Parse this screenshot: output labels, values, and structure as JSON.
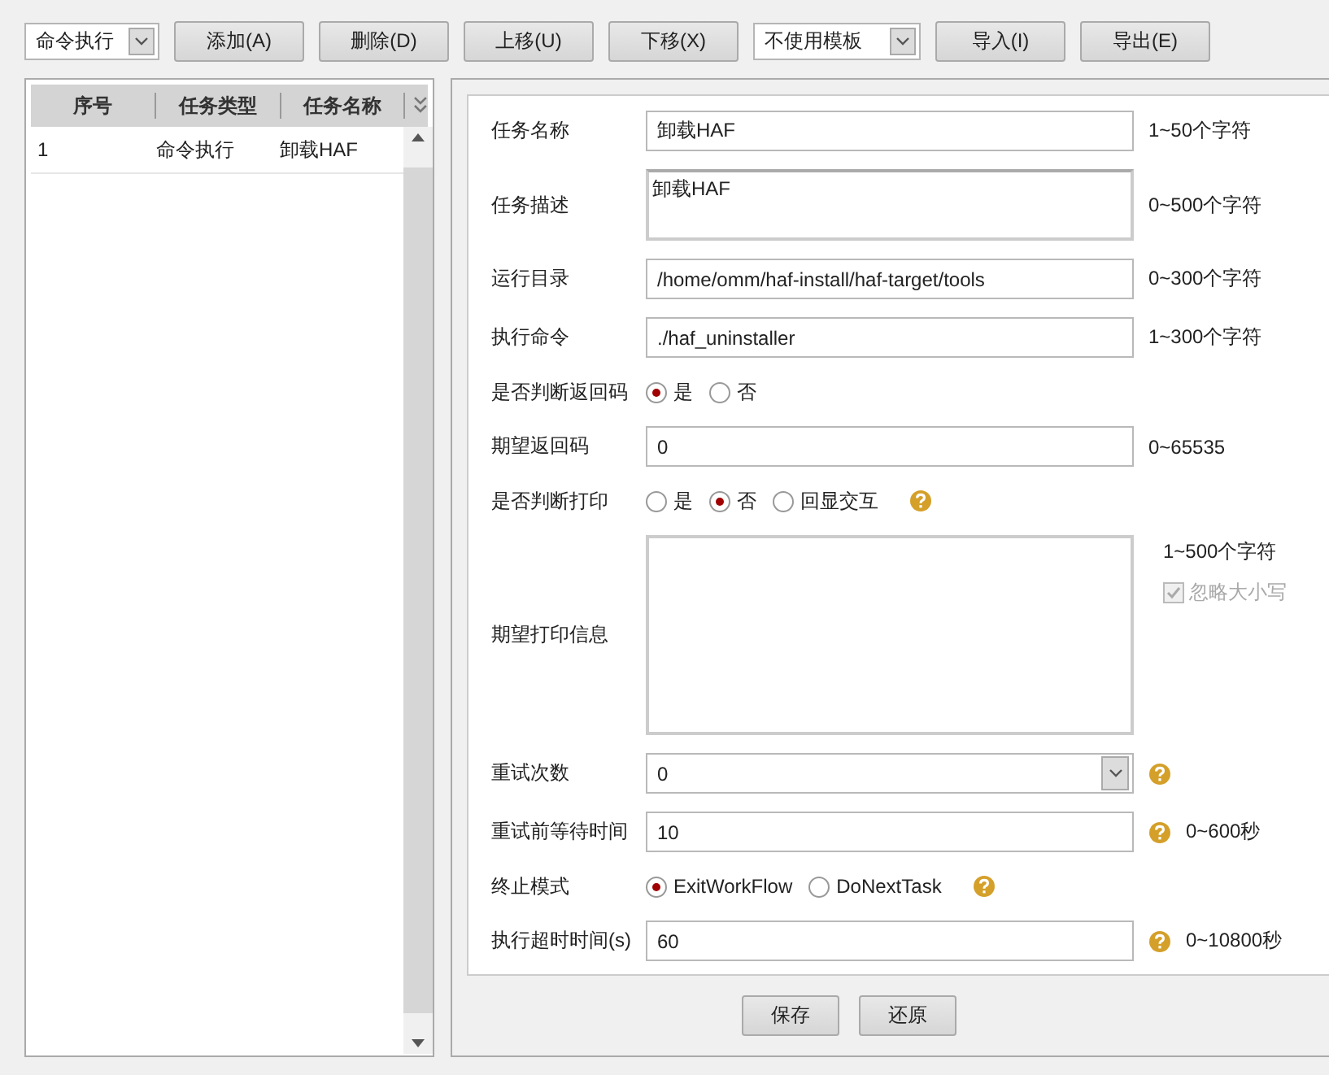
{
  "toolbar": {
    "type_select": {
      "value": "命令执行"
    },
    "buttons_left": [
      "添加(A)",
      "删除(D)",
      "上移(U)",
      "下移(X)"
    ],
    "template_select": {
      "value": "不使用模板"
    },
    "buttons_right": [
      "导入(I)",
      "导出(E)"
    ]
  },
  "task_table": {
    "columns": [
      "序号",
      "任务类型",
      "任务名称"
    ],
    "rows": [
      {
        "cells": [
          "1",
          "命令执行",
          "卸载HAF"
        ],
        "selected": false
      }
    ]
  },
  "form": {
    "rows": [
      {
        "kind": "text",
        "label": "任务名称",
        "value": "卸载HAF",
        "hint": "1~50个字符",
        "help": false
      },
      {
        "kind": "textarea",
        "label": "任务描述",
        "value": "卸载HAF",
        "hint": "0~500个字符",
        "help": false
      },
      {
        "kind": "text",
        "label": "运行目录",
        "value": "/home/omm/haf-install/haf-target/tools",
        "hint": "0~300个字符",
        "help": false
      },
      {
        "kind": "text",
        "label": "执行命令",
        "value": "./haf_uninstaller",
        "hint": "1~300个字符",
        "help": false
      },
      {
        "kind": "radio",
        "label": "是否判断返回码",
        "options": [
          {
            "label": "是",
            "selected": true
          },
          {
            "label": "否",
            "selected": false
          }
        ],
        "help": false
      },
      {
        "kind": "text",
        "label": "期望返回码",
        "value": "0",
        "hint": "0~65535",
        "help": false
      },
      {
        "kind": "radio",
        "label": "是否判断打印",
        "options": [
          {
            "label": "是",
            "selected": false
          },
          {
            "label": "否",
            "selected": true
          },
          {
            "label": "回显交互",
            "selected": false
          }
        ],
        "help": true
      },
      {
        "kind": "bigtext",
        "label": "期望打印信息",
        "hint": "1~500个字符",
        "checkbox": {
          "label": "忽略大小写",
          "checked": true,
          "disabled": true
        },
        "help": false
      },
      {
        "kind": "select",
        "label": "重试次数",
        "value": "0",
        "help": true
      },
      {
        "kind": "text",
        "label": "重试前等待时间",
        "value": "10",
        "hint": "0~600秒",
        "help": true
      },
      {
        "kind": "radio",
        "label": "终止模式",
        "options": [
          {
            "label": "ExitWorkFlow",
            "selected": true
          },
          {
            "label": "DoNextTask",
            "selected": false
          }
        ],
        "help": true
      },
      {
        "kind": "text",
        "label": "执行超时时间(s)",
        "value": "60",
        "hint": "0~10800秒",
        "help": true
      }
    ]
  },
  "footer_buttons": [
    "保存",
    "还原"
  ]
}
